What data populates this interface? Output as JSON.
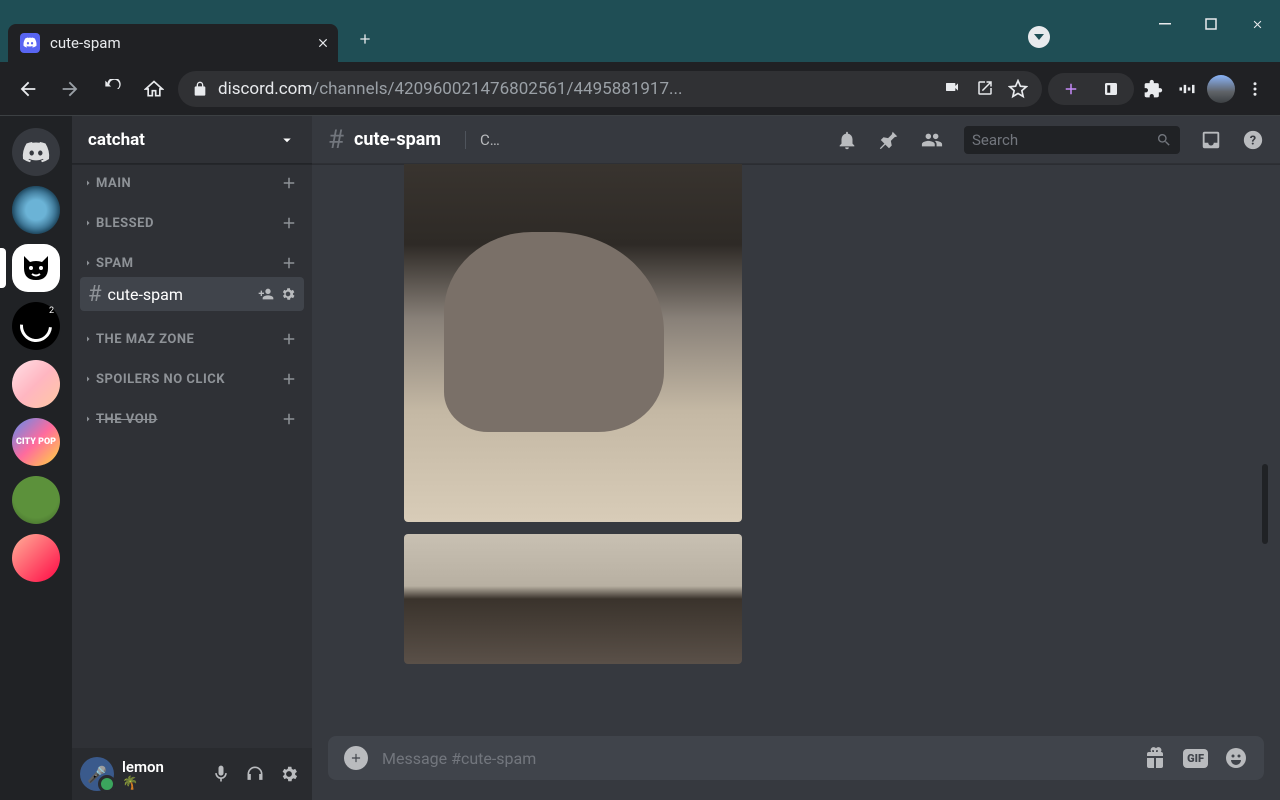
{
  "browser": {
    "tab_title": "cute-spam",
    "url_display_domain": "discord.com",
    "url_display_path": "/channels/420960021476802561/4495881917..."
  },
  "server": {
    "name": "catchat"
  },
  "categories": [
    {
      "label": "MAIN"
    },
    {
      "label": "BLESSED"
    },
    {
      "label": "SPAM"
    },
    {
      "label": "THE MAZ ZONE"
    },
    {
      "label": "SPOILERS NO CLICK"
    },
    {
      "label": "THE VOID",
      "strike": true
    }
  ],
  "active_channel": {
    "name": "cute-spam"
  },
  "moon_badge": "2",
  "citypop_label": "CITY POP",
  "header": {
    "channel_name": "cute-spam",
    "topic": "C...",
    "search_placeholder": "Search"
  },
  "user": {
    "name": "lemon",
    "status_emoji": "🌴"
  },
  "composer": {
    "placeholder": "Message #cute-spam",
    "gif_label": "GIF"
  }
}
